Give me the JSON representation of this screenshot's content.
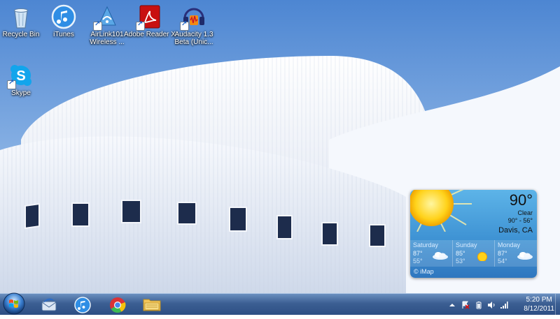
{
  "desktop": {
    "icons": [
      {
        "label": "Recycle Bin",
        "icon": "recycle-bin-icon"
      },
      {
        "label": "iTunes",
        "icon": "itunes-icon"
      },
      {
        "label": "AirLink101 Wireless ...",
        "icon": "airlink-icon"
      },
      {
        "label": "Adobe Reader X",
        "icon": "adobe-reader-icon"
      },
      {
        "label": "Audacity 1.3 Beta (Unic...",
        "icon": "audacity-icon"
      },
      {
        "label": "Skype",
        "icon": "skype-icon"
      }
    ]
  },
  "weather": {
    "temp": "90°",
    "condition": "Clear",
    "range": "90° - 56°",
    "city": "Davis, CA",
    "days": [
      {
        "name": "Saturday",
        "hi": "87°",
        "lo": "55°",
        "icon": "cloud-icon"
      },
      {
        "name": "Sunday",
        "hi": "85°",
        "lo": "53°",
        "icon": "sun-icon"
      },
      {
        "name": "Monday",
        "hi": "87°",
        "lo": "54°",
        "icon": "cloud-icon"
      }
    ],
    "credit": "© iMap"
  },
  "taskbar": {
    "pinned": [
      "thunderbird-icon",
      "itunes-icon",
      "chrome-icon",
      "explorer-folder-icon"
    ],
    "tray": [
      "tray-up-arrow-icon",
      "flag-alert-icon",
      "battery-icon",
      "volume-icon",
      "network-signal-icon"
    ],
    "time": "5:20 PM",
    "date": "8/12/2011"
  },
  "colors": {
    "sky": "#5b8fd6",
    "building": "#e9eef7",
    "taskbar": "#3c5f93",
    "gadget": "#3f93d4"
  }
}
